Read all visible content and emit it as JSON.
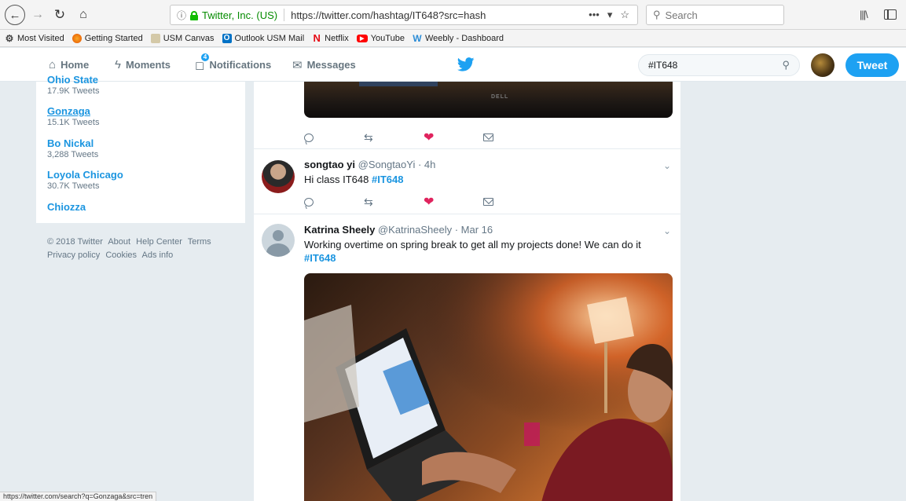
{
  "browser": {
    "site_identity": "Twitter, Inc. (US)",
    "url": "https://twitter.com/hashtag/IT648?src=hash",
    "search_placeholder": "Search",
    "url_more": "•••",
    "status_url": "https://twitter.com/search?q=Gonzaga&src=tren",
    "bookmarks": [
      {
        "label": "Most Visited",
        "icon": "gear-icon"
      },
      {
        "label": "Getting Started",
        "icon": "firefox-icon"
      },
      {
        "label": "USM Canvas",
        "icon": "canvas-icon"
      },
      {
        "label": "Outlook USM Mail",
        "icon": "outlook-icon"
      },
      {
        "label": "Netflix",
        "icon": "netflix-icon"
      },
      {
        "label": "YouTube",
        "icon": "youtube-icon"
      },
      {
        "label": "Weebly - Dashboard",
        "icon": "weebly-icon"
      }
    ]
  },
  "twitter": {
    "nav": {
      "home": "Home",
      "moments": "Moments",
      "notifications": "Notifications",
      "notifications_count": "4",
      "messages": "Messages"
    },
    "search_value": "#IT648",
    "tweet_button": "Tweet"
  },
  "trends": [
    {
      "name": "Ohio State",
      "count": "17.9K Tweets"
    },
    {
      "name": "Gonzaga",
      "count": "15.1K Tweets"
    },
    {
      "name": "Bo Nickal",
      "count": "3,288 Tweets"
    },
    {
      "name": "Loyola Chicago",
      "count": "30.7K Tweets"
    },
    {
      "name": "Chiozza",
      "count": ""
    }
  ],
  "footer": {
    "line1": [
      "© 2018 Twitter",
      "About",
      "Help Center",
      "Terms"
    ],
    "line2": [
      "Privacy policy",
      "Cookies",
      "Ads info"
    ]
  },
  "tweets": [
    {
      "name": "songtao yi",
      "handle": "@SongtaoYi",
      "time": "· 4h",
      "text": "Hi class IT648",
      "hashtag": "#IT648"
    },
    {
      "name": "Katrina Sheely",
      "handle": "@KatrinaSheely",
      "time": "· Mar 16",
      "text": "Working overtime on spring break to get all my projects done! We can do it",
      "hashtag": "#IT648"
    }
  ],
  "photo_brand": "DELL"
}
